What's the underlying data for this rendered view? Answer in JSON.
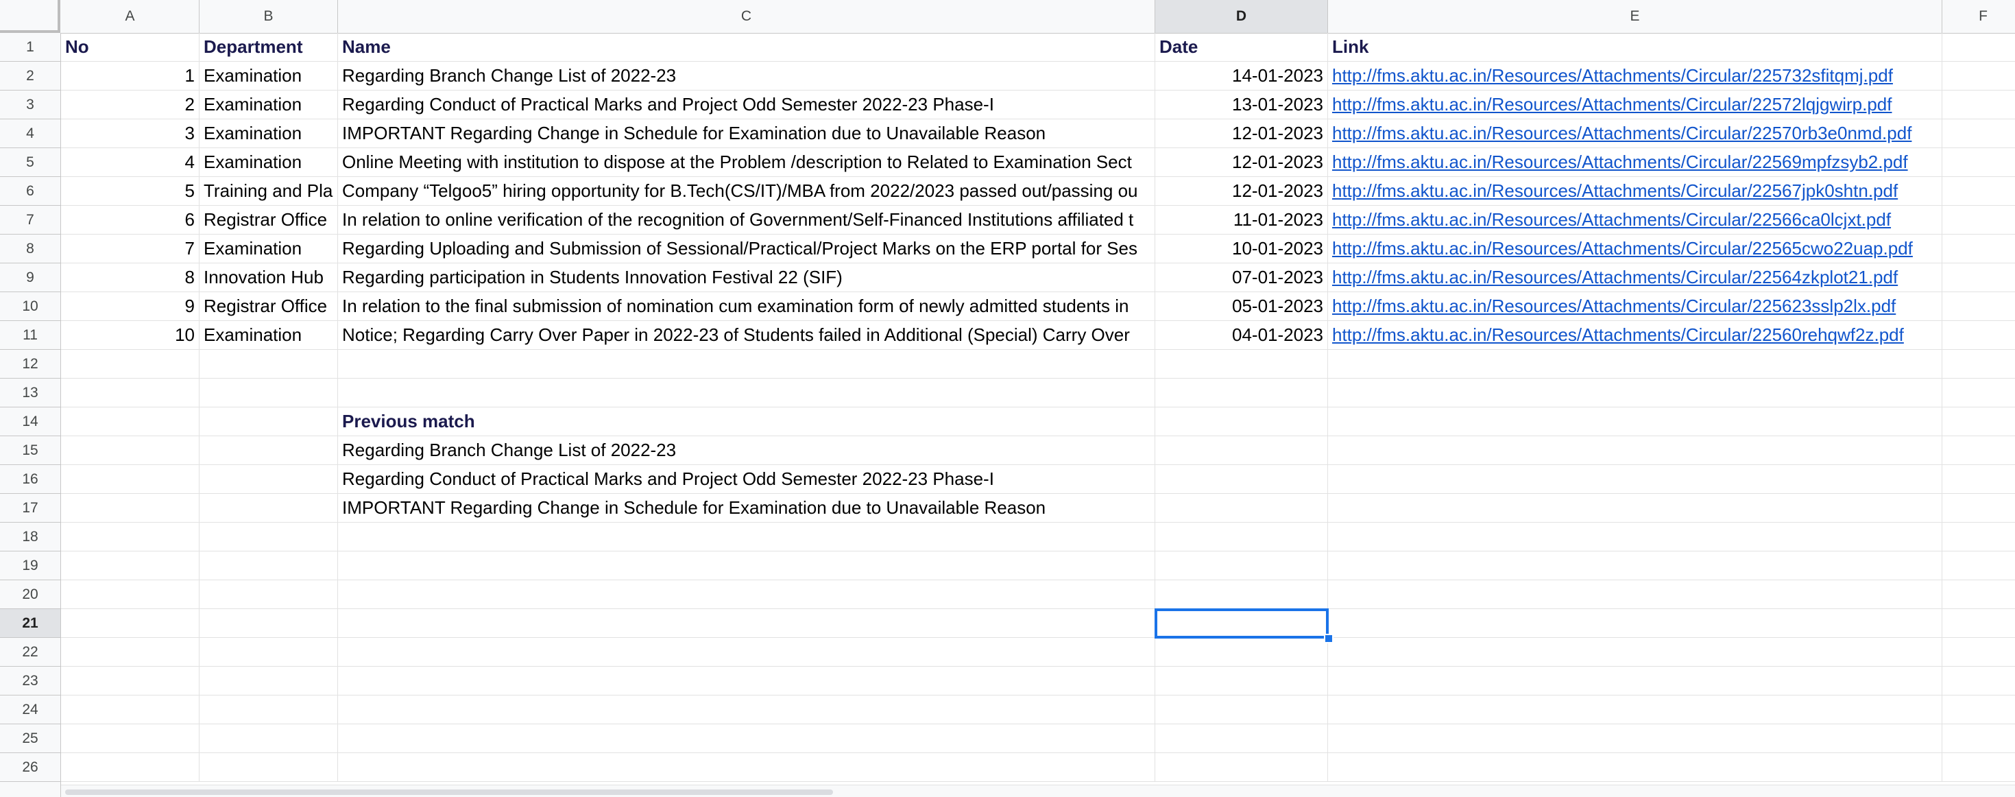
{
  "columns": [
    "A",
    "B",
    "C",
    "D",
    "E",
    "F"
  ],
  "rows": [
    "1",
    "2",
    "3",
    "4",
    "5",
    "6",
    "7",
    "8",
    "9",
    "10",
    "11",
    "12",
    "13",
    "14",
    "15",
    "16",
    "17",
    "18",
    "19",
    "20",
    "21",
    "22",
    "23",
    "24",
    "25",
    "26"
  ],
  "active_cell": {
    "column": "D",
    "row": "21"
  },
  "header": {
    "no": "No",
    "department": "Department",
    "name": "Name",
    "date": "Date",
    "link": "Link"
  },
  "records": [
    {
      "no": "1",
      "department": "Examination",
      "name": "Regarding Branch Change List of 2022-23",
      "date": "14-01-2023",
      "link": "http://fms.aktu.ac.in/Resources/Attachments/Circular/225732sfitqmj.pdf"
    },
    {
      "no": "2",
      "department": "Examination",
      "name": "Regarding Conduct of Practical Marks and Project Odd Semester 2022-23 Phase-I",
      "date": "13-01-2023",
      "link": "http://fms.aktu.ac.in/Resources/Attachments/Circular/22572lqjgwirp.pdf"
    },
    {
      "no": "3",
      "department": "Examination",
      "name": "IMPORTANT Regarding Change in Schedule for Examination due to Unavailable Reason",
      "date": "12-01-2023",
      "link": "http://fms.aktu.ac.in/Resources/Attachments/Circular/22570rb3e0nmd.pdf"
    },
    {
      "no": "4",
      "department": "Examination",
      "name": "Online Meeting with institution to dispose at the Problem /description to Related to Examination Sect",
      "date": "12-01-2023",
      "link": "http://fms.aktu.ac.in/Resources/Attachments/Circular/22569mpfzsyb2.pdf"
    },
    {
      "no": "5",
      "department": "Training and Pla",
      "name": "Company “Telgoo5” hiring opportunity for B.Tech(CS/IT)/MBA from 2022/2023 passed out/passing ou",
      "date": "12-01-2023",
      "link": "http://fms.aktu.ac.in/Resources/Attachments/Circular/22567jpk0shtn.pdf"
    },
    {
      "no": "6",
      "department": "Registrar Office",
      "name": "In relation to online verification of the recognition of Government/Self-Financed Institutions affiliated t",
      "date": "11-01-2023",
      "link": "http://fms.aktu.ac.in/Resources/Attachments/Circular/22566ca0lcjxt.pdf"
    },
    {
      "no": "7",
      "department": "Examination",
      "name": "Regarding Uploading and Submission of Sessional/Practical/Project Marks on the ERP portal for Ses",
      "date": "10-01-2023",
      "link": "http://fms.aktu.ac.in/Resources/Attachments/Circular/22565cwo22uap.pdf"
    },
    {
      "no": "8",
      "department": "Innovation Hub",
      "name": "Regarding participation in Students Innovation Festival 22 (SIF)",
      "date": "07-01-2023",
      "link": "http://fms.aktu.ac.in/Resources/Attachments/Circular/22564zkplot21.pdf"
    },
    {
      "no": "9",
      "department": "Registrar Office",
      "name": "In relation to the final submission of nomination cum examination form of newly admitted students in",
      "date": "05-01-2023",
      "link": "http://fms.aktu.ac.in/Resources/Attachments/Circular/225623sslp2lx.pdf"
    },
    {
      "no": "10",
      "department": "Examination",
      "name": "Notice; Regarding Carry Over Paper in 2022-23 of Students failed in Additional (Special) Carry Over",
      "date": "04-01-2023",
      "link": "http://fms.aktu.ac.in/Resources/Attachments/Circular/22560rehqwf2z.pdf"
    }
  ],
  "previous_match": {
    "title": "Previous match",
    "items": [
      "Regarding Branch Change List of 2022-23",
      "Regarding Conduct of Practical Marks and Project Odd Semester 2022-23 Phase-I",
      "IMPORTANT Regarding Change in Schedule for Examination due to Unavailable Reason"
    ]
  },
  "colors": {
    "header_text": "#1b1a4e",
    "link": "#1155cc",
    "selection": "#1a73e8"
  }
}
